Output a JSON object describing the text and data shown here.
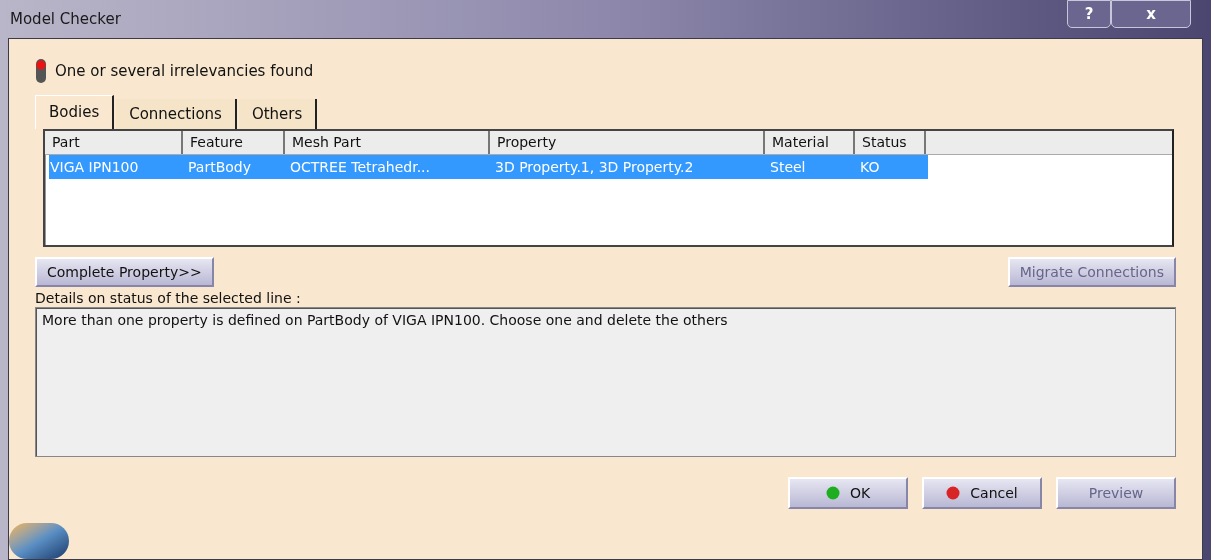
{
  "window": {
    "title": "Model Checker",
    "buttons": [
      "?",
      "x"
    ]
  },
  "status": {
    "message": "One or several irrelevancies found",
    "ok": false
  },
  "tabs": [
    {
      "label": "Bodies",
      "selected": true
    },
    {
      "label": "Connections",
      "selected": false
    },
    {
      "label": "Others",
      "selected": false
    }
  ],
  "table": {
    "columns": [
      "Part",
      "Feature",
      "Mesh Part",
      "Property",
      "Material",
      "Status"
    ],
    "rows": [
      {
        "cells": [
          "VIGA IPN100",
          "PartBody",
          "OCTREE Tetrahedr...",
          "3D Property.1, 3D Property.2",
          "Steel",
          "KO"
        ],
        "selected": true
      }
    ]
  },
  "actions": [
    {
      "label": "Complete Property>>",
      "disabled": false
    },
    {
      "label": "Migrate Connections",
      "disabled": true
    }
  ],
  "details": {
    "label": "Details on status of the selected line :",
    "text": "More than one property is defined on PartBody of VIGA IPN100. Choose one and delete the others"
  },
  "footer_buttons": [
    {
      "label": "OK",
      "kind": "ok",
      "disabled": false
    },
    {
      "label": "Cancel",
      "kind": "cancel",
      "disabled": false
    },
    {
      "label": "Preview",
      "kind": "plain",
      "disabled": true
    }
  ]
}
